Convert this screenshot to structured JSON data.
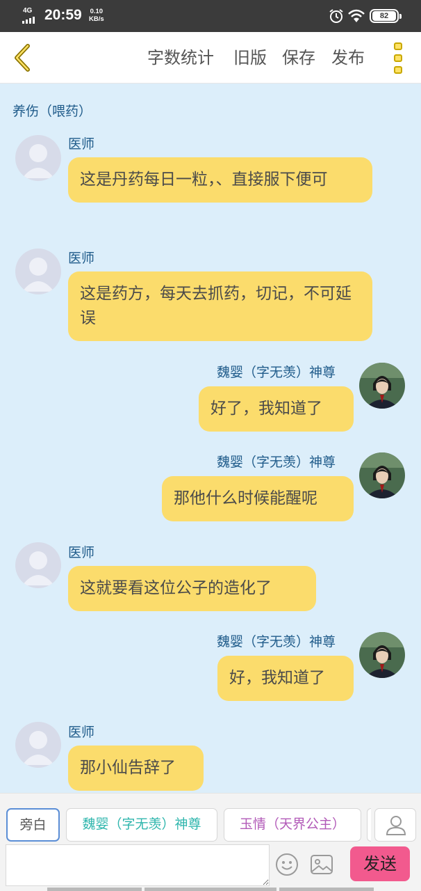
{
  "status_bar": {
    "network": "4G",
    "time": "20:59",
    "speed_value": "0.10",
    "speed_unit": "KB/s",
    "battery": "82"
  },
  "app_bar": {
    "menu": [
      "字数统计",
      "旧版",
      "保存",
      "发布"
    ],
    "back_icon": "chevron-left-icon",
    "more_icon": "three-squares-vertical-icon",
    "accent_color": "#c8a800"
  },
  "chat": {
    "title": "养伤（喂药）",
    "messages": [
      {
        "side": "left",
        "sender": "医师",
        "text": "这是丹药每日一粒，、直接服下便可",
        "avatar": "default-avatar"
      },
      {
        "side": "left",
        "sender": "医师",
        "text": "这是药方，每天去抓药，切记，不可延误",
        "avatar": "default-avatar"
      },
      {
        "side": "right",
        "sender": "魏婴（字无羡）神尊",
        "text": "好了，我知道了",
        "avatar": "character-avatar"
      },
      {
        "side": "right",
        "sender": "魏婴（字无羡）神尊",
        "text": "那他什么时候能醒呢",
        "avatar": "character-avatar"
      },
      {
        "side": "left",
        "sender": "医师",
        "text": "这就要看这位公子的造化了",
        "avatar": "default-avatar"
      },
      {
        "side": "right",
        "sender": "魏婴（字无羡）神尊",
        "text": "好，我知道了",
        "avatar": "character-avatar"
      },
      {
        "side": "left",
        "sender": "医师",
        "text": "那小仙告辞了",
        "avatar": "default-avatar"
      }
    ],
    "bubble_color": "#fbdc6c"
  },
  "roles": [
    {
      "label": "旁白",
      "selected": true
    },
    {
      "label": "魏婴（字无羡）神尊",
      "selected": false
    },
    {
      "label": "玉情（天界公主）",
      "selected": false
    }
  ],
  "input": {
    "placeholder": "",
    "send_label": "发送",
    "send_color": "#f25a8e"
  }
}
